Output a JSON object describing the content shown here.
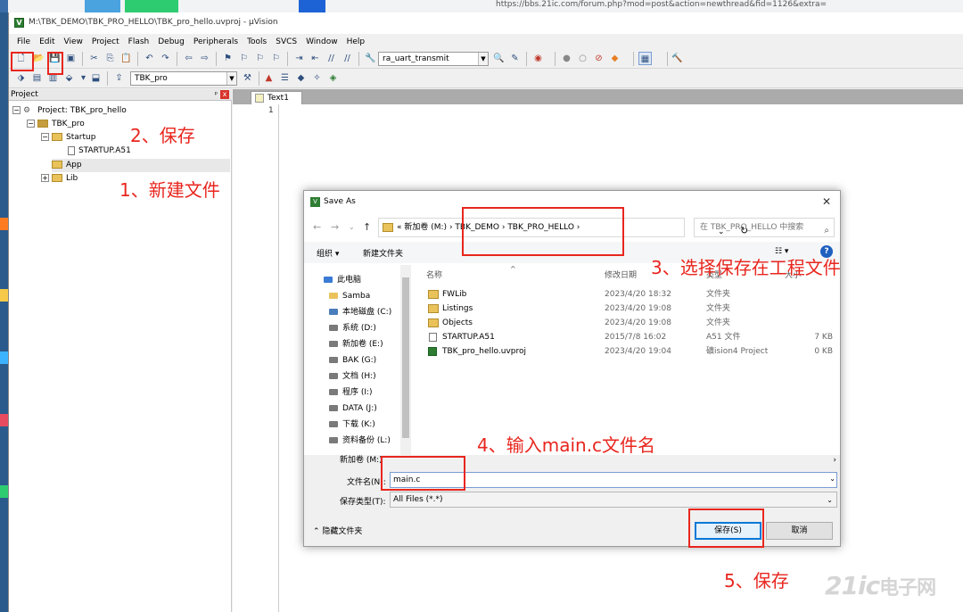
{
  "browser": {
    "url": "https://bbs.21ic.com/forum.php?mod=post&action=newthread&fid=1126&extra="
  },
  "window": {
    "title": "M:\\TBK_DEMO\\TBK_PRO_HELLO\\TBK_pro_hello.uvproj - µVision"
  },
  "menubar": [
    "File",
    "Edit",
    "View",
    "Project",
    "Flash",
    "Debug",
    "Peripherals",
    "Tools",
    "SVCS",
    "Window",
    "Help"
  ],
  "toolbar": {
    "function_combo": "ra_uart_transmit",
    "target_combo": "TBK_pro"
  },
  "project_panel": {
    "title": "Project",
    "tree": {
      "project": "Project: TBK_pro_hello",
      "target": "TBK_pro",
      "startup_group": "Startup",
      "startup_file": "STARTUP.A51",
      "app_group": "App",
      "lib_group": "Lib"
    }
  },
  "editor": {
    "tab": "Text1",
    "line_number": "1"
  },
  "dialog": {
    "title": "Save As",
    "address": {
      "prefix": "«",
      "segments": [
        "新加卷 (M:)",
        "TBK_DEMO",
        "TBK_PRO_HELLO"
      ]
    },
    "search_placeholder": "在 TBK_PRO_HELLO 中搜索",
    "commands": {
      "organize": "组织 ▾",
      "new_folder": "新建文件夹"
    },
    "nav_items": [
      "此电脑",
      "Samba",
      "本地磁盘 (C:)",
      "系统 (D:)",
      "新加卷 (E:)",
      "BAK (G:)",
      "文档 (H:)",
      "程序 (I:)",
      "DATA (J:)",
      "下载 (K:)",
      "资料备份 (L:)"
    ],
    "hscroll_label": "新加卷 (M:)",
    "columns": {
      "name": "名称",
      "date": "修改日期",
      "type": "类型",
      "size": "大小"
    },
    "files": [
      {
        "name": "FWLib",
        "date": "2023/4/20 18:32",
        "type": "文件夹",
        "size": ""
      },
      {
        "name": "Listings",
        "date": "2023/4/20 19:08",
        "type": "文件夹",
        "size": ""
      },
      {
        "name": "Objects",
        "date": "2023/4/20 19:08",
        "type": "文件夹",
        "size": ""
      },
      {
        "name": "STARTUP.A51",
        "date": "2015/7/8 16:02",
        "type": "A51 文件",
        "size": "7 KB"
      },
      {
        "name": "TBK_pro_hello.uvproj",
        "date": "2023/4/20 19:04",
        "type": "礦ision4 Project",
        "size": "0 KB"
      }
    ],
    "filename_label": "文件名(N):",
    "filename_value": "main.c",
    "filetype_label": "保存类型(T):",
    "filetype_value": "All Files (*.*)",
    "hide_folders": "隐藏文件夹",
    "save_button": "保存(S)",
    "cancel_button": "取消"
  },
  "annotations": {
    "step1": "1、新建文件",
    "step2": "2、保存",
    "step3": "3、选择保存在工程文件",
    "step4": "4、输入main.c文件名",
    "step5": "5、保存",
    "accent_color": "#e8261e"
  },
  "watermark": {
    "logo": "21ic",
    "text": "电子网"
  }
}
